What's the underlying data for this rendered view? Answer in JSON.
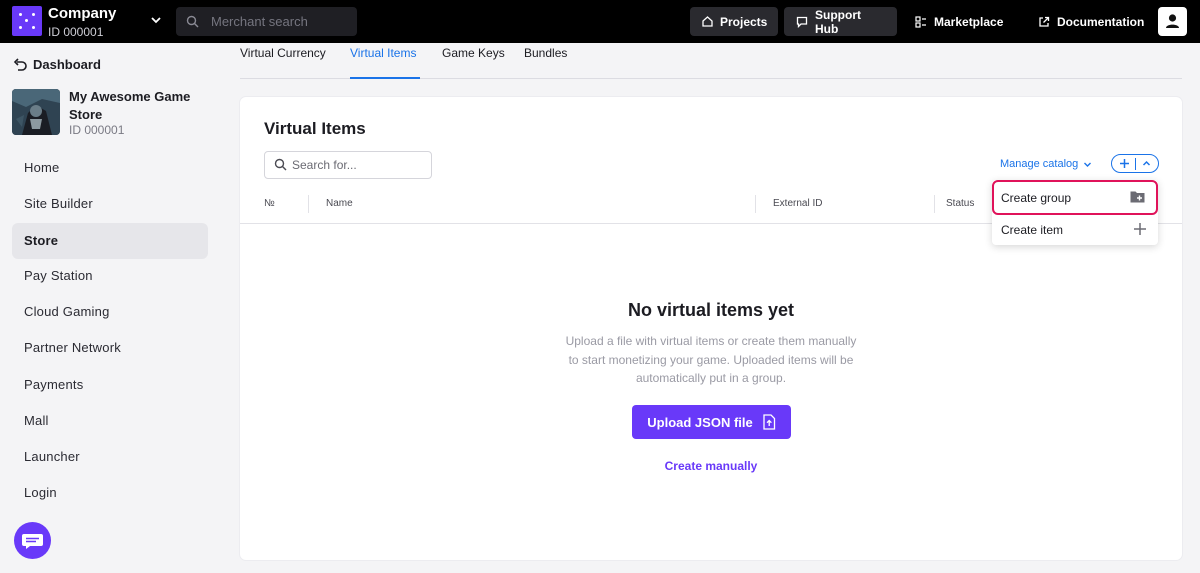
{
  "topbar": {
    "company_name": "Company",
    "company_id": "ID 000001",
    "search_placeholder": "Merchant search",
    "projects_label": "Projects",
    "support_label": "Support Hub",
    "marketplace_label": "Marketplace",
    "documentation_label": "Documentation"
  },
  "sidebar": {
    "dashboard_label": "Dashboard",
    "project_name": "My Awesome Game Store",
    "project_id": "ID 000001",
    "items": [
      {
        "label": "Home"
      },
      {
        "label": "Site Builder"
      },
      {
        "label": "Store",
        "active": true
      },
      {
        "label": "Pay Station"
      },
      {
        "label": "Cloud Gaming"
      },
      {
        "label": "Partner Network"
      },
      {
        "label": "Payments"
      },
      {
        "label": "Mall"
      },
      {
        "label": "Launcher"
      },
      {
        "label": "Login"
      }
    ]
  },
  "tabs": [
    {
      "label": "Virtual Currency"
    },
    {
      "label": "Virtual Items",
      "active": true
    },
    {
      "label": "Game Keys"
    },
    {
      "label": "Bundles"
    }
  ],
  "main": {
    "title": "Virtual Items",
    "search_placeholder": "Search for...",
    "manage_catalog": "Manage catalog",
    "columns": [
      "№",
      "Name",
      "External ID",
      "Status"
    ],
    "empty_title": "No virtual items yet",
    "empty_desc": "Upload a file with virtual items or create them manually to start monetizing your game. Uploaded items will be automatically put in a group.",
    "upload_label": "Upload JSON file",
    "create_manually": "Create manually"
  },
  "dropdown": {
    "create_group": "Create group",
    "create_item": "Create item"
  },
  "colors": {
    "accent_purple": "#6939f9",
    "link_blue": "#1a73e8",
    "highlight_pink": "#e0135a",
    "topbar_bg": "#000000"
  }
}
